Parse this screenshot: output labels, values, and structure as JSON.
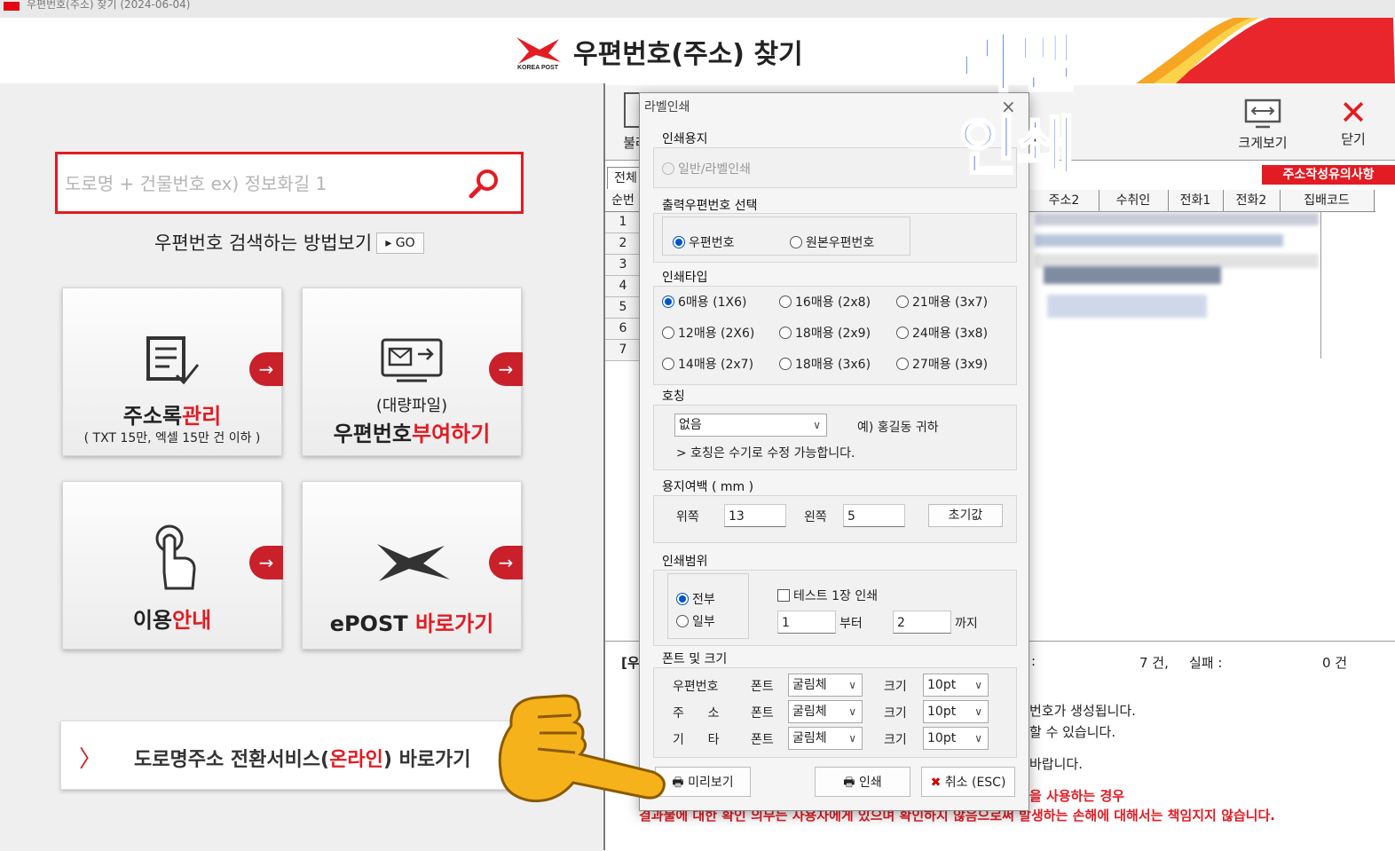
{
  "window": {
    "title": "우편번호(주소) 찾기 (2024-06-04)"
  },
  "header": {
    "title": "우편번호(주소) 찾기",
    "logo_text": "KOREA POST"
  },
  "overlay": {
    "line1": "라벨",
    "line2": "인쇄"
  },
  "left": {
    "search": {
      "placeholder": "도로명 + 건물번호 ex) 정보화길 1"
    },
    "howto": "우편번호 검색하는 방법보기",
    "go": "GO",
    "tiles": [
      {
        "title_black": "주소록",
        "title_red": "관리",
        "sub": "( TXT 15만, 엑셀 15만 건 이하 )",
        "icon": "document-edit-icon"
      },
      {
        "sub_top": "(대량파일)",
        "title_black": "우편번호",
        "title_red": "부여하기",
        "icon": "mail-monitor-icon"
      },
      {
        "title_black": "이용",
        "title_red": "안내",
        "icon": "touch-hand-icon"
      },
      {
        "title_black": "ePOST ",
        "title_red": "바로가기",
        "icon": "epost-logo-icon"
      }
    ],
    "bottom_link": {
      "prefix": "도로명주소 전환서비스(",
      "red": "온라인",
      "suffix": ") 바로가기"
    }
  },
  "toolbar": {
    "load": "불러",
    "print_partial": "인",
    "zoom": "크게보기",
    "close": "닫기",
    "notice": "주소작성유의사항"
  },
  "grid": {
    "tab": "전체",
    "col_seq": "순번",
    "columns": [
      "주소2",
      "수취인",
      "전화1",
      "전화2",
      "집배코드"
    ],
    "rows": [
      "1",
      "2",
      "3",
      "4",
      "5",
      "6",
      "7"
    ]
  },
  "status": {
    "prefix": "[우",
    "count_label": "7 건,",
    "fail_label": "실패 :",
    "fail_count": "0 건",
    "colon": ":",
    "line1": "번호가 생성됩니다.",
    "line2": "할 수 있습니다.",
    "line3": "바랍니다.",
    "warn1": "을 사용하는 경우",
    "warn2": "결과물에 대한 확인 의무는 사용자에게 있으며 확인하지 않음으로써 발생하는 손해에 대해서는 책임지지 않습니다."
  },
  "dialog": {
    "title": "라벨인쇄",
    "paper": {
      "title": "인쇄용지",
      "option": "일반/라벨인쇄"
    },
    "zip_select": {
      "title": "출력우편번호 선택",
      "opt1": "우편번호",
      "opt2": "원본우편번호"
    },
    "print_type": {
      "title": "인쇄타입",
      "options": [
        "6매용  (1X6)",
        "16매용 (2x8)",
        "21매용 (3x7)",
        "12매용 (2X6)",
        "18매용 (2x9)",
        "24매용 (3x8)",
        "14매용 (2x7)",
        "18매용 (3x6)",
        "27매용 (3x9)"
      ]
    },
    "honorific": {
      "title": "호칭",
      "value": "없음",
      "example": "예) 홍길동 귀하",
      "note": "> 호칭은 수기로 수정 가능합니다."
    },
    "margin": {
      "title": "용지여백 ( mm )",
      "top_label": "위쪽",
      "top_value": "13",
      "left_label": "왼쪽",
      "left_value": "5",
      "reset": "초기값"
    },
    "range": {
      "title": "인쇄범위",
      "all": "전부",
      "partial": "일부",
      "test": "테스트 1장 인쇄",
      "from_value": "1",
      "from_label": "부터",
      "to_value": "2",
      "to_label": "까지"
    },
    "font": {
      "title": "폰트 및 크기",
      "rows": [
        {
          "label": "우편번호",
          "font_label": "폰트",
          "font": "굴림체",
          "size_label": "크기",
          "size": "10pt"
        },
        {
          "label": "주      소",
          "font_label": "폰트",
          "font": "굴림체",
          "size_label": "크기",
          "size": "10pt"
        },
        {
          "label": "기      타",
          "font_label": "폰트",
          "font": "굴림체",
          "size_label": "크기",
          "size": "10pt"
        }
      ]
    },
    "buttons": {
      "preview": "미리보기",
      "print": "인쇄",
      "cancel": "취소 (ESC)"
    }
  },
  "colors": {
    "accent_red": "#e31b23",
    "overlay_blue": "#1548d6",
    "radio_blue": "#0055cc"
  }
}
